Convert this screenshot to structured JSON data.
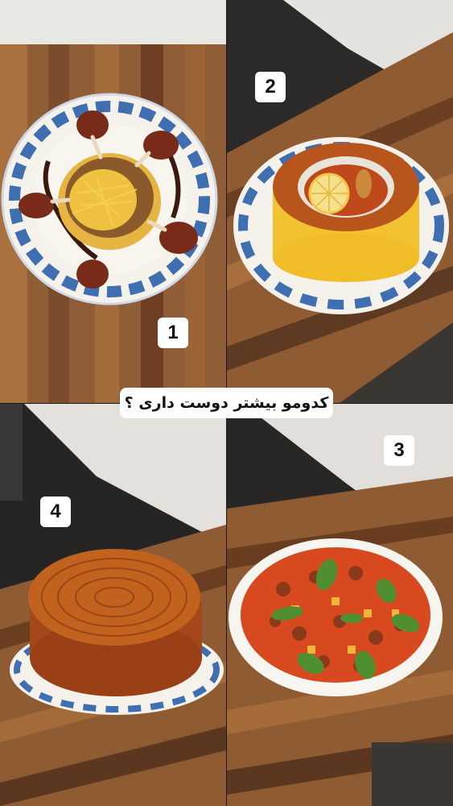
{
  "question": "کدومو بیشتر دوست داری ؟",
  "dishes": [
    {
      "number": "1"
    },
    {
      "number": "2"
    },
    {
      "number": "3"
    },
    {
      "number": "4"
    }
  ],
  "colors": {
    "wood": "#8a5a35",
    "plate_blue": "#3f6fb0",
    "saffron_rice": "#f2c230",
    "tahdig_crust": "#b8551c",
    "tomato_stew": "#d8491f",
    "basil": "#4f8f2f"
  }
}
